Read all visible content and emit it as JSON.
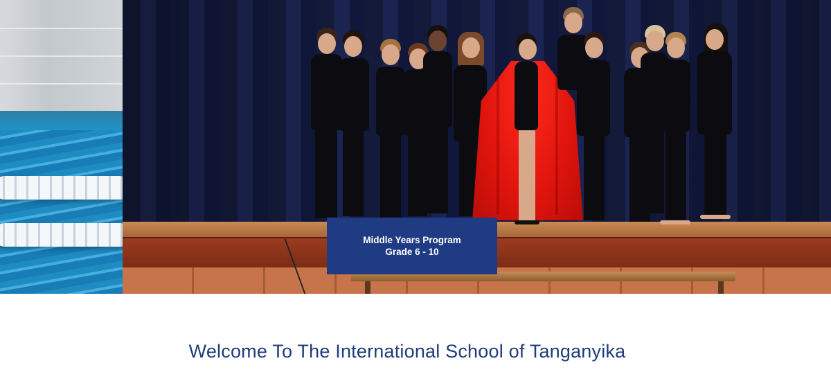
{
  "hero": {
    "left_image": "swimming-pool-photo",
    "main_image": "theatre-stage-performance-photo",
    "caption": {
      "line1": "Middle Years Program",
      "line2": "Grade 6 - 10",
      "background_color": "#1f3b83",
      "text_color": "#ffffff"
    }
  },
  "welcome": {
    "title": "Welcome To The International School of Tanganyika",
    "color": "#1f3b7a"
  }
}
